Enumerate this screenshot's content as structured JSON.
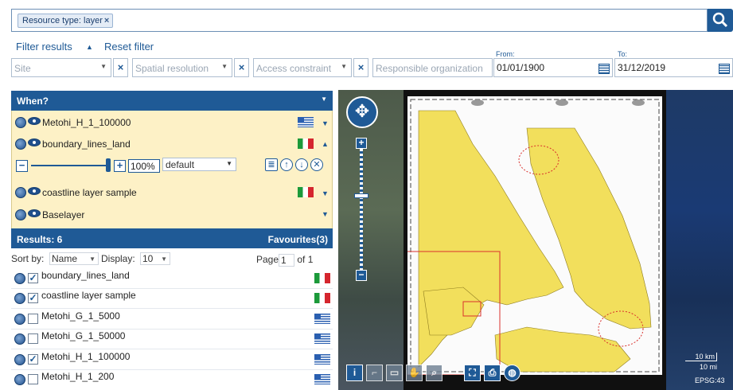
{
  "search": {
    "tag_label": "Resource type: layer",
    "tag_remove": "×",
    "search_icon": "magnifier-icon"
  },
  "filters": {
    "filter_results": "Filter results",
    "reset_filter": "Reset filter",
    "site": "Site",
    "spatial_resolution": "Spatial resolution",
    "access_constraint": "Access constraint",
    "responsible_org": "Responsible organization",
    "clear": "×",
    "from_label": "From:",
    "from_value": "01/01/1900",
    "to_label": "To:",
    "to_value": "31/12/2019"
  },
  "when_panel": {
    "title": "When?",
    "layers": [
      {
        "name": "Metohi_H_1_100000",
        "flag": "gr",
        "expanded": false
      },
      {
        "name": "boundary_lines_land",
        "flag": "it",
        "expanded": true
      },
      {
        "name": "coastline layer sample",
        "flag": "it",
        "expanded": false
      },
      {
        "name": "Baselayer",
        "flag": "",
        "expanded": false
      }
    ],
    "opacity": {
      "minus": "−",
      "plus": "+",
      "value": "100%",
      "level": 1.0
    },
    "style_value": "default"
  },
  "results": {
    "title": "Results: 6",
    "favourites": "Favourites(3)",
    "sort_label": "Sort by:",
    "sort_value": "Name",
    "display_label": "Display:",
    "display_value": "10",
    "page_label": "Page",
    "page_value": "1",
    "page_of": "of 1",
    "items": [
      {
        "name": "boundary_lines_land",
        "checked": true,
        "flag": "it"
      },
      {
        "name": "coastline layer sample",
        "checked": true,
        "flag": "it"
      },
      {
        "name": "Metohi_G_1_5000",
        "checked": false,
        "flag": "gr"
      },
      {
        "name": "Metohi_G_1_50000",
        "checked": false,
        "flag": "gr"
      },
      {
        "name": "Metohi_H_1_100000",
        "checked": true,
        "flag": "gr"
      },
      {
        "name": "Metohi_H_1_200",
        "checked": false,
        "flag": "gr"
      }
    ]
  },
  "map": {
    "scale_km": "10 km",
    "scale_mi": "10 mi",
    "epsg": "EPSG:43",
    "colors": {
      "land": "#f2df5c",
      "sea": "#ffffff",
      "panel": "#1f5a96"
    }
  }
}
